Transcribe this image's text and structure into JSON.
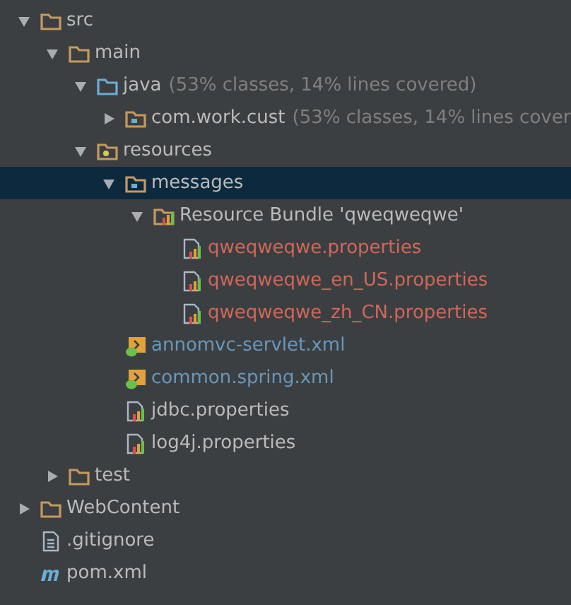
{
  "project_tree": [
    {
      "label": "src",
      "kind": "folder",
      "expanded": true,
      "selected": false,
      "color": "#bbbbbb",
      "children": [
        {
          "label": "main",
          "kind": "folder",
          "expanded": true,
          "selected": false,
          "color": "#bbbbbb",
          "children": [
            {
              "label": "java",
              "note": "(53% classes, 14% lines covered)",
              "kind": "source-folder",
              "expanded": true,
              "selected": false,
              "color": "#bbbbbb",
              "children": [
                {
                  "label": "com.work.cust",
                  "note": "(53% classes, 14% lines cover",
                  "kind": "package",
                  "expanded": false,
                  "selected": false,
                  "color": "#bbbbbb"
                }
              ]
            },
            {
              "label": "resources",
              "kind": "resources-folder",
              "expanded": true,
              "selected": false,
              "color": "#bbbbbb",
              "children": [
                {
                  "label": "messages",
                  "kind": "package",
                  "expanded": true,
                  "selected": true,
                  "color": "#bbbbbb",
                  "children": [
                    {
                      "label": "Resource Bundle 'qweqweqwe'",
                      "kind": "bundle",
                      "expanded": true,
                      "selected": false,
                      "color": "#bbbbbb",
                      "children": [
                        {
                          "label": "qweqweqwe.properties",
                          "kind": "properties",
                          "selected": false,
                          "color": "#d1675a"
                        },
                        {
                          "label": "qweqweqwe_en_US.properties",
                          "kind": "properties",
                          "selected": false,
                          "color": "#d1675a"
                        },
                        {
                          "label": "qweqweqwe_zh_CN.properties",
                          "kind": "properties",
                          "selected": false,
                          "color": "#d1675a"
                        }
                      ]
                    }
                  ]
                },
                {
                  "label": "annomvc-servlet.xml",
                  "kind": "spring-xml",
                  "selected": false,
                  "color": "#6897bb"
                },
                {
                  "label": "common.spring.xml",
                  "kind": "spring-xml",
                  "selected": false,
                  "color": "#6897bb"
                },
                {
                  "label": "jdbc.properties",
                  "kind": "properties",
                  "selected": false,
                  "color": "#bbbbbb"
                },
                {
                  "label": "log4j.properties",
                  "kind": "properties",
                  "selected": false,
                  "color": "#bbbbbb"
                }
              ]
            }
          ]
        },
        {
          "label": "test",
          "kind": "folder",
          "expanded": false,
          "selected": false,
          "color": "#bbbbbb"
        }
      ]
    },
    {
      "label": "WebContent",
      "kind": "folder",
      "expanded": false,
      "selected": false,
      "color": "#bbbbbb"
    },
    {
      "label": ".gitignore",
      "kind": "text-file",
      "selected": false,
      "color": "#bbbbbb"
    },
    {
      "label": "pom.xml",
      "kind": "maven",
      "selected": false,
      "color": "#bbbbbb"
    }
  ]
}
